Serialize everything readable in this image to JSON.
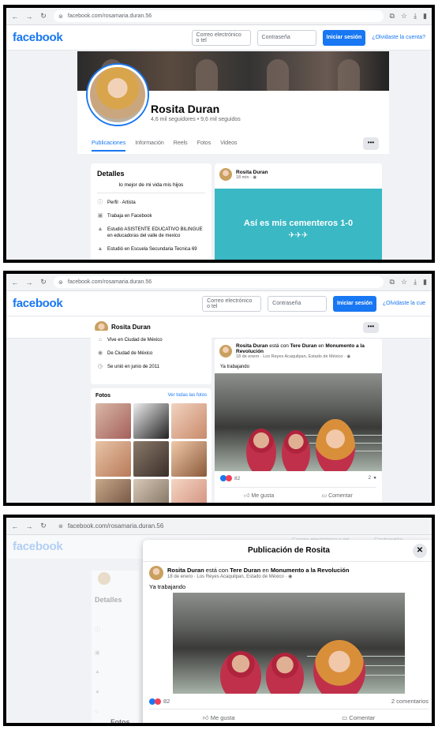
{
  "browser": {
    "url": "facebook.com/rosamaria.duran.56",
    "url_short": "facebook.com/rosamaria.duran.56"
  },
  "header": {
    "logo": "facebook",
    "email_placeholder": "Correo electrónico o teléfono",
    "email_short": "Correo electrónico o tel",
    "password_placeholder": "Contraseña",
    "login_label": "Iniciar sesión",
    "forgot_label": "¿Olvidaste la cuenta?",
    "forgot_short": "¿Olvidaste la cue"
  },
  "profile": {
    "name": "Rosita Duran",
    "stats": "4,6 mil seguidores • 9,6 mil seguidos",
    "tabs": [
      "Publicaciones",
      "Información",
      "Reels",
      "Fotos",
      "Videos"
    ],
    "more": "•••"
  },
  "details": {
    "title": "Detalles",
    "bio": "lo mejor de mi vida mis hijos",
    "rows": [
      {
        "icon": "info-icon",
        "text": "Perfil · Artista"
      },
      {
        "icon": "briefcase-icon",
        "text": "Trabaja en Facebook"
      },
      {
        "icon": "graduation-icon",
        "text": "Estudió ASISTENTE EDUCATIVO BILINGUE en educadoras del valle de mexico"
      },
      {
        "icon": "graduation-icon",
        "text": "Estudió en Escuela Secundaria Tecnica 69"
      }
    ]
  },
  "post1": {
    "author": "Rosita Duran",
    "time": "18 min · ",
    "text": "Así es mis cementeros 1-0",
    "emoji": "✈✈✈"
  },
  "info2": {
    "rows": [
      {
        "icon": "home-icon",
        "text": "Vive en Ciudad de México"
      },
      {
        "icon": "location-icon",
        "text": "De Ciudad de México"
      },
      {
        "icon": "clock-icon",
        "text": "Se unió en junio de 2011"
      }
    ]
  },
  "fotos": {
    "title": "Fotos",
    "link": "Ver todas las fotos"
  },
  "post2": {
    "author": "Rosita Duran",
    "tagline_pre": "está con",
    "with": "Tere Duran",
    "tagline_mid": "en",
    "place": "Monumento a la Revolución",
    "meta": "18 de enero · Los Reyes Acaquilpan, Estado de México · ",
    "text": "Ya trabajando",
    "reactions": "82",
    "comments": "2",
    "comments_full": "2 comentarios",
    "like": "Me gusta",
    "comment": "Comentar"
  },
  "modal": {
    "title": "Publicación de Rosita",
    "close": "✕"
  },
  "colors": {
    "brand": "#1877f2",
    "teal": "#3ab8c4"
  }
}
